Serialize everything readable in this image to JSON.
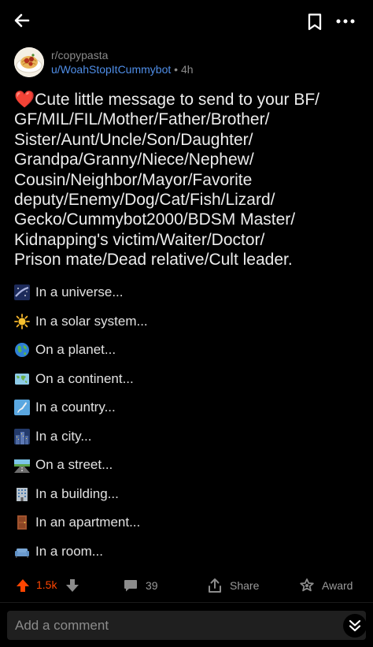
{
  "header": {
    "back_icon": "arrow-left-icon",
    "bookmark_icon": "bookmark-icon",
    "more_icon": "more-horizontal-icon"
  },
  "post": {
    "subreddit": "r/copypasta",
    "author": "u/WoahStopItCummybot",
    "separator": "•",
    "age": "4h",
    "title_emoji": "❤️",
    "title": "Cute little message to send to your BF/ GF/MIL/FIL/Mother/Father/Brother/ Sister/Aunt/Uncle/Son/Daughter/ Grandpa/Granny/Niece/Nephew/ Cousin/Neighbor/Mayor/Favorite deputy/Enemy/Dog/Cat/Fish/Lizard/ Gecko/Cummybot2000/BDSM Master/ Kidnapping's victim/Waiter/Doctor/ Prison mate/Dead relative/Cult leader.",
    "title_lines": [
      "Cute little message to send to your BF/",
      "GF/MIL/FIL/Mother/Father/Brother/",
      "Sister/Aunt/Uncle/Son/Daughter/",
      "Grandpa/Granny/Niece/Nephew/",
      "Cousin/Neighbor/Mayor/Favorite",
      "deputy/Enemy/Dog/Cat/Fish/Lizard/",
      "Gecko/Cummybot2000/BDSM Master/",
      "Kidnapping's victim/Waiter/Doctor/",
      "Prison mate/Dead relative/Cult leader."
    ],
    "body_lines": [
      {
        "icon": "milky-way-icon",
        "text": "In a universe..."
      },
      {
        "icon": "sun-icon",
        "text": "In a solar system..."
      },
      {
        "icon": "globe-icon",
        "text": "On a planet..."
      },
      {
        "icon": "world-map-icon",
        "text": "On a continent..."
      },
      {
        "icon": "map-of-japan-icon",
        "text": "In a country..."
      },
      {
        "icon": "night-city-icon",
        "text": "In a city..."
      },
      {
        "icon": "motorway-icon",
        "text": "On a street..."
      },
      {
        "icon": "office-building-icon",
        "text": "In a building..."
      },
      {
        "icon": "door-icon",
        "text": "In an apartment..."
      },
      {
        "icon": "couch-icon",
        "text": "In a room..."
      }
    ]
  },
  "actions": {
    "upvote_icon": "upvote-arrow-icon",
    "votes": "1.5k",
    "downvote_icon": "downvote-arrow-icon",
    "comment_icon": "comment-bubble-icon",
    "comments": "39",
    "share_icon": "share-icon",
    "share_label": "Share",
    "award_icon": "award-icon",
    "award_label": "Award"
  },
  "comment_box": {
    "placeholder": "Add a comment",
    "collapse_icon": "double-chevron-down-icon"
  },
  "colors": {
    "background": "#000000",
    "upvote_active": "#ff4500",
    "username": "#4f8ee8",
    "muted": "#8a8a8a"
  }
}
